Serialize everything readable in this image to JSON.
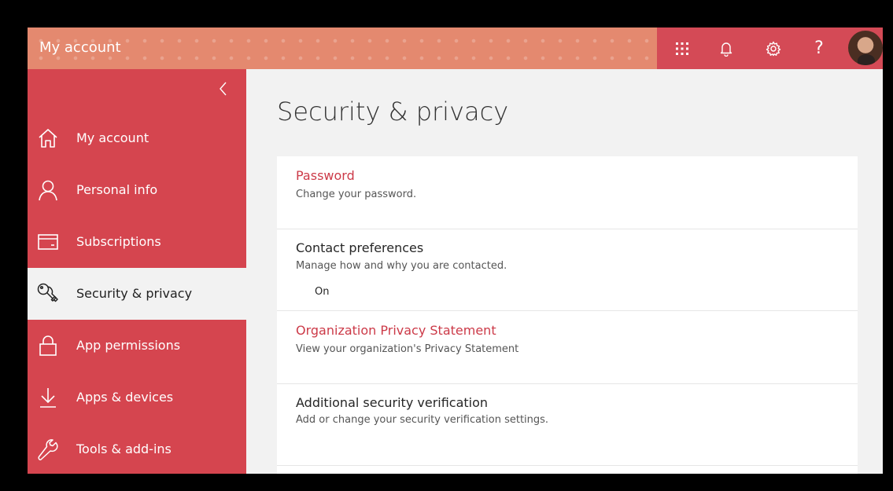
{
  "header": {
    "title": "My account",
    "help_glyph": "?",
    "buttons": [
      {
        "name": "app-launcher",
        "icon": "waffle-icon"
      },
      {
        "name": "notifications",
        "icon": "bell-icon"
      },
      {
        "name": "settings",
        "icon": "gear-icon"
      },
      {
        "name": "help",
        "icon": "question-icon"
      }
    ]
  },
  "sidebar": {
    "items": [
      {
        "label": "My account",
        "icon": "home-icon"
      },
      {
        "label": "Personal info",
        "icon": "person-icon"
      },
      {
        "label": "Subscriptions",
        "icon": "card-icon"
      },
      {
        "label": "Security & privacy",
        "icon": "keys-icon",
        "active": true
      },
      {
        "label": "App permissions",
        "icon": "lock-icon"
      },
      {
        "label": "Apps & devices",
        "icon": "download-icon"
      },
      {
        "label": "Tools & add-ins",
        "icon": "wrench-icon"
      }
    ]
  },
  "main": {
    "title": "Security & privacy",
    "sections": [
      {
        "title": "Password",
        "description": "Change your password."
      },
      {
        "title": "Contact preferences",
        "description": "Manage how and why you are contacted.",
        "state": "On"
      },
      {
        "title": "Organization Privacy Statement",
        "description": "View your organization's Privacy Statement"
      },
      {
        "title": "Additional security verification",
        "description": "Add or change your security verification settings."
      }
    ]
  },
  "colors": {
    "accent": "#d5454f",
    "header_bg": "#e4896f",
    "link": "#cc3a48",
    "content_bg": "#f2f2f2"
  }
}
